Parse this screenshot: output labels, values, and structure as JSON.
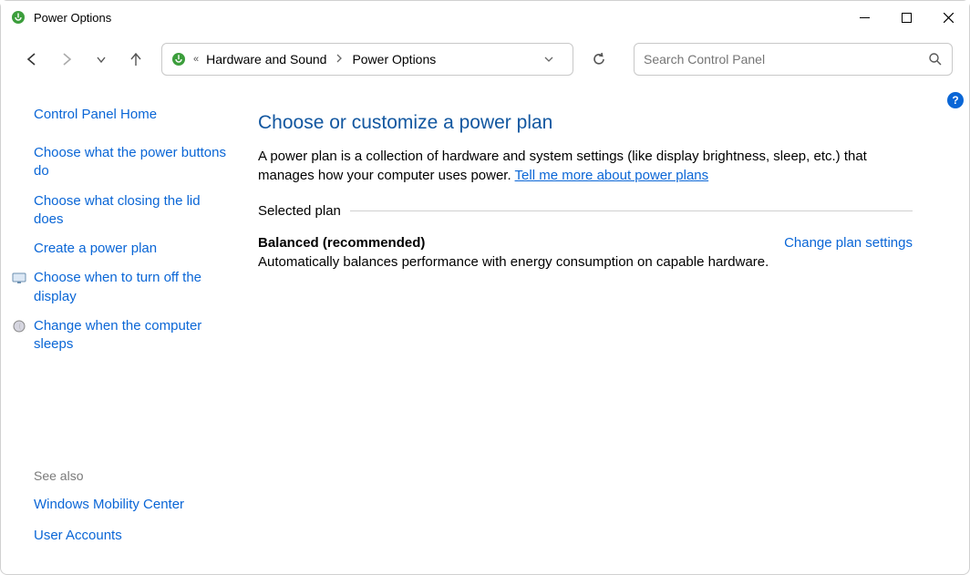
{
  "window": {
    "title": "Power Options"
  },
  "breadcrumb": {
    "item1": "Hardware and Sound",
    "item2": "Power Options"
  },
  "search": {
    "placeholder": "Search Control Panel"
  },
  "sidebar": {
    "home": "Control Panel Home",
    "links": [
      {
        "label": "Choose what the power buttons do",
        "icon": null
      },
      {
        "label": "Choose what closing the lid does",
        "icon": null
      },
      {
        "label": "Create a power plan",
        "icon": null
      },
      {
        "label": "Choose when to turn off the display",
        "icon": "display"
      },
      {
        "label": "Change when the computer sleeps",
        "icon": "moon"
      }
    ],
    "see_also_label": "See also",
    "see_also": [
      {
        "label": "Windows Mobility Center"
      },
      {
        "label": "User Accounts"
      }
    ]
  },
  "main": {
    "title": "Choose or customize a power plan",
    "description_pre": "A power plan is a collection of hardware and system settings (like display brightness, sleep, etc.) that manages how your computer uses power. ",
    "description_link": "Tell me more about power plans",
    "selected_plan_label": "Selected plan",
    "plan": {
      "name": "Balanced (recommended)",
      "desc": "Automatically balances performance with energy consumption on capable hardware."
    },
    "change_link": "Change plan settings"
  }
}
